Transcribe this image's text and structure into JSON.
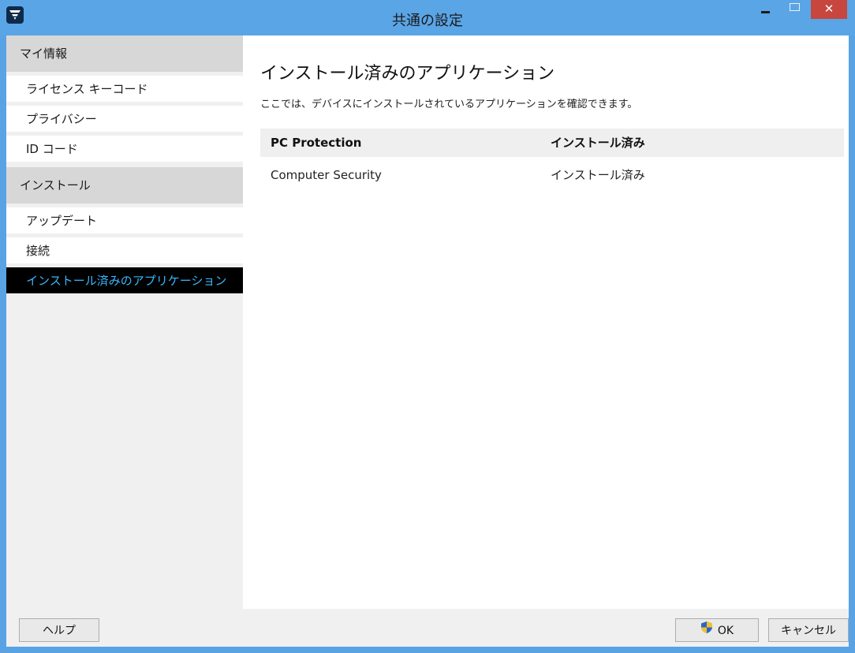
{
  "window": {
    "title": "共通の設定",
    "close_glyph": "✕"
  },
  "sidebar": {
    "groups": [
      {
        "label": "マイ情報",
        "items": [
          {
            "label": "ライセンス キーコード"
          },
          {
            "label": "プライバシー"
          },
          {
            "label": "ID コード"
          }
        ]
      },
      {
        "label": "インストール",
        "items": [
          {
            "label": "アップデート"
          },
          {
            "label": "接続"
          },
          {
            "label": "インストール済みのアプリケーション",
            "active": true
          }
        ]
      }
    ]
  },
  "main": {
    "title": "インストール済みのアプリケーション",
    "description": "ここでは、デバイスにインストールされているアプリケーションを確認できます。",
    "table": {
      "columns": [
        "PC Protection",
        "インストール済み"
      ],
      "rows": [
        [
          "Computer Security",
          "インストール済み"
        ]
      ]
    }
  },
  "footer": {
    "help_label": "ヘルプ",
    "ok_label": "OK",
    "cancel_label": "キャンセル"
  },
  "colors": {
    "titlebar": "#5aa5e6",
    "active_item_bg": "#000000",
    "active_item_text": "#39b8ff",
    "close_button": "#c7463e",
    "group_header_bg": "#d7d7d7"
  },
  "icons": {
    "app_logo": "app-logo-icon",
    "minimize": "minimize-icon",
    "maximize": "maximize-icon",
    "close": "close-icon",
    "ok_shield": "uac-shield-icon"
  }
}
